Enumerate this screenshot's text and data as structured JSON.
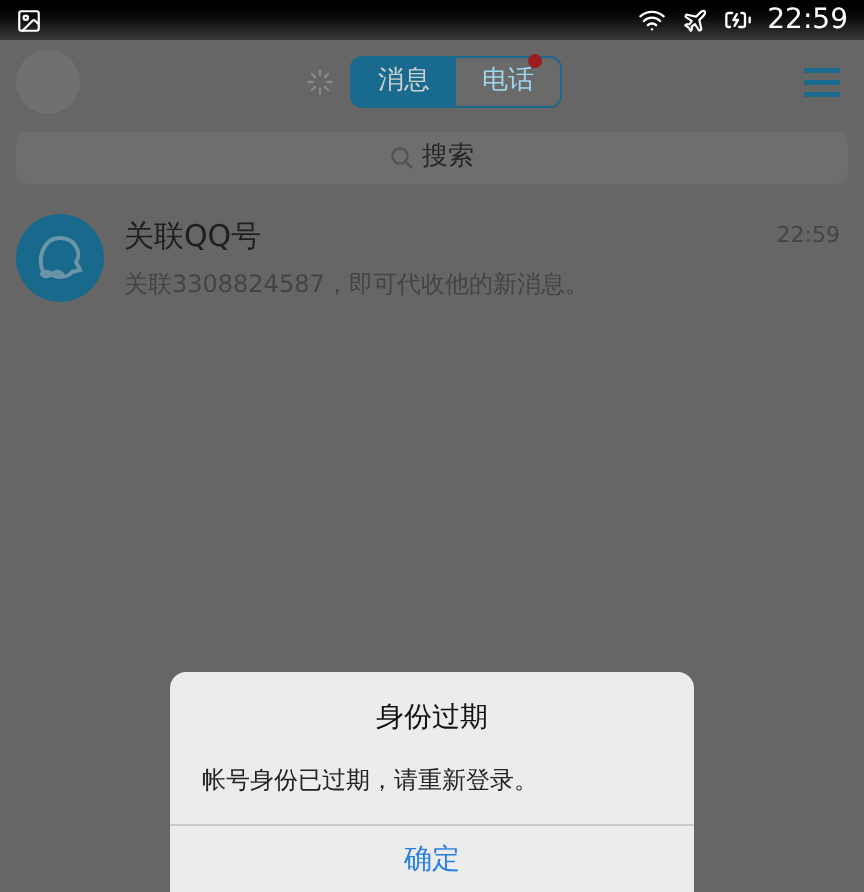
{
  "status_bar": {
    "time": "22:59"
  },
  "header": {
    "tabs": [
      {
        "label": "消息",
        "selected": true,
        "has_dot": false
      },
      {
        "label": "电话",
        "selected": false,
        "has_dot": true
      }
    ]
  },
  "search": {
    "placeholder": "搜索"
  },
  "conversations": [
    {
      "name": "关联QQ号",
      "preview": "关联3308824587，即可代收他的新消息。",
      "time": "22:59"
    }
  ],
  "dialog": {
    "title": "身份过期",
    "message": "帐号身份已过期，请重新登录。",
    "button": "确定"
  }
}
